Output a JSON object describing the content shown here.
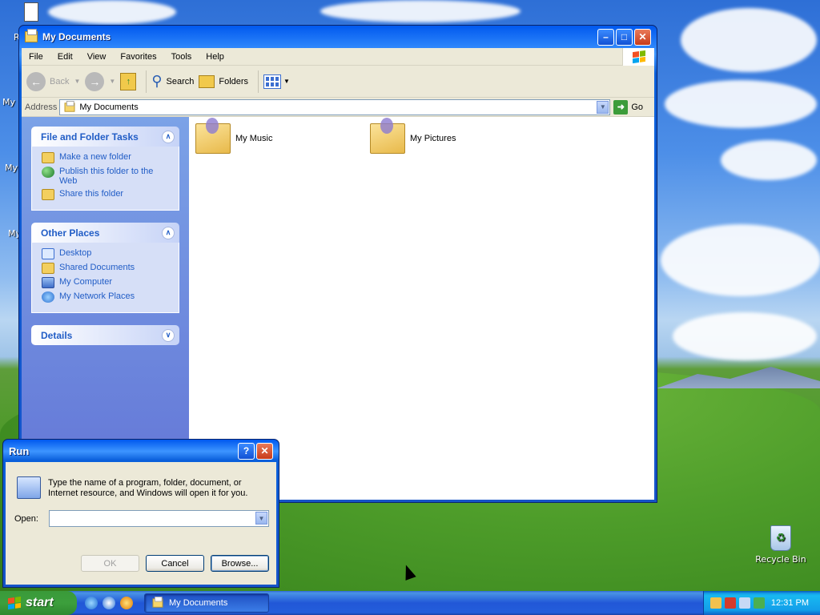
{
  "desktop": {
    "clipped_labels": [
      "R",
      "My I",
      "My",
      "My"
    ],
    "recycle_bin": "Recycle Bin"
  },
  "window": {
    "title": "My Documents",
    "menu": [
      "File",
      "Edit",
      "View",
      "Favorites",
      "Tools",
      "Help"
    ],
    "toolbar": {
      "back": "Back",
      "search": "Search",
      "folders": "Folders"
    },
    "address": {
      "label": "Address",
      "value": "My Documents",
      "go": "Go"
    },
    "taskpane": {
      "file_folder_tasks": {
        "title": "File and Folder Tasks",
        "items": [
          "Make a new folder",
          "Publish this folder to the Web",
          "Share this folder"
        ]
      },
      "other_places": {
        "title": "Other Places",
        "items": [
          "Desktop",
          "Shared Documents",
          "My Computer",
          "My Network Places"
        ]
      },
      "details": {
        "title": "Details"
      }
    },
    "content": {
      "items": [
        "My Music",
        "My Pictures"
      ]
    }
  },
  "run_dialog": {
    "title": "Run",
    "description": "Type the name of a program, folder, document, or Internet resource, and Windows will open it for you.",
    "open_label": "Open:",
    "open_value": "",
    "ok": "OK",
    "cancel": "Cancel",
    "browse": "Browse..."
  },
  "taskbar": {
    "start": "start",
    "task": "My Documents",
    "clock": "12:31 PM"
  }
}
